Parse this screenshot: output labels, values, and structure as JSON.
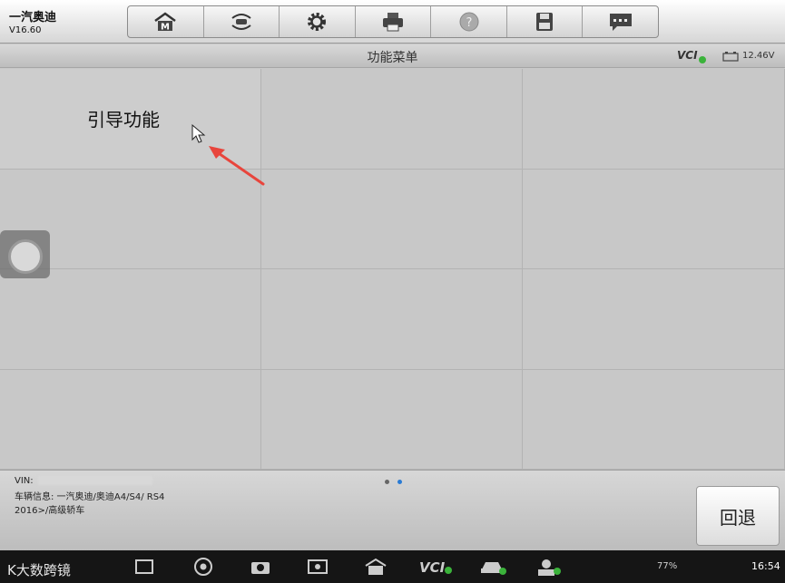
{
  "app": {
    "title": "一汽奥迪",
    "version": "V16.60"
  },
  "toolbar": {
    "buttons": [
      {
        "icon": "home-m-icon"
      },
      {
        "icon": "vehicle-swap-icon"
      },
      {
        "icon": "gear-icon"
      },
      {
        "icon": "printer-icon"
      },
      {
        "icon": "help-icon"
      },
      {
        "icon": "save-icon"
      },
      {
        "icon": "message-icon"
      }
    ]
  },
  "titlebar": {
    "title": "功能菜单",
    "vci": "VCI",
    "voltage": "12.46V"
  },
  "menu": {
    "items": [
      "引导功能",
      "",
      "",
      "",
      "",
      "",
      "",
      "",
      "",
      "",
      "",
      ""
    ]
  },
  "footer": {
    "vin_label": "VIN:",
    "vehicle_info": "车辆信息: 一汽奥迪/奥迪A4/S4/ RS4 2016>/高级轿车",
    "back_label": "回退",
    "page_count": 2,
    "active_page": 2
  },
  "navbar": {
    "watermark": "K大数跨镜",
    "status": "77%",
    "clock": "16:54"
  },
  "colors": {
    "accent_arrow": "#e8453c",
    "vci_ok": "#3bb33b",
    "page_dot_active": "#2a7bd4"
  }
}
